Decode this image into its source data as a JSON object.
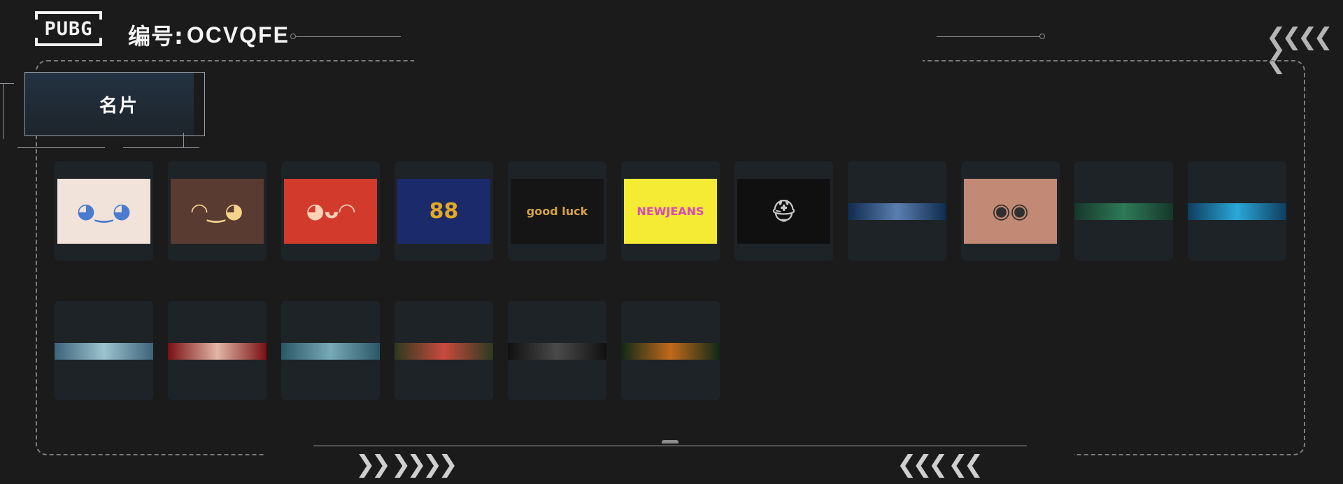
{
  "header": {
    "logo_text": "PUBG",
    "code_label": "编号:",
    "code_value": "OCVQFE"
  },
  "section": {
    "title": "名片"
  },
  "cards": [
    {
      "id": "anime-blonde",
      "type": "image",
      "bg": "#f1e3da",
      "glyph": "◕‿◕",
      "glyph_color": "#4a7bd0"
    },
    {
      "id": "anime-brunette",
      "type": "image",
      "bg": "#5a3b31",
      "glyph": "◠‿◕",
      "glyph_color": "#f4d38a"
    },
    {
      "id": "anime-red",
      "type": "image",
      "bg": "#d23a2c",
      "glyph": "◕ᴗ◠",
      "glyph_color": "#ffd2b8"
    },
    {
      "id": "gold-88",
      "type": "image",
      "bg": "#1b2a6b",
      "glyph": "88",
      "glyph_color": "#e3a91f"
    },
    {
      "id": "good-luck",
      "type": "image",
      "bg": "#151515",
      "glyph": "good luck",
      "glyph_color": "#d6a545"
    },
    {
      "id": "newjeans",
      "type": "image",
      "bg": "#f5ea34",
      "glyph": "NEWJEANS",
      "glyph_color": "#d84ab6"
    },
    {
      "id": "soldier-helmet",
      "type": "image",
      "bg": "#101010",
      "glyph": "⛑",
      "glyph_color": "#c9c9c9"
    },
    {
      "id": "moon-phases",
      "type": "banner",
      "color": "#0f2a4d",
      "accent": "#5a7fb0"
    },
    {
      "id": "goggles-woman",
      "type": "image",
      "bg": "#c28a74",
      "glyph": "◉◉",
      "glyph_color": "#2f2f2f"
    },
    {
      "id": "green-camo",
      "type": "banner",
      "color": "#16372b",
      "accent": "#2e7a57"
    },
    {
      "id": "blue-light",
      "type": "banner",
      "color": "#0f3d5f",
      "accent": "#2aa8d8"
    },
    {
      "id": "mountain-haze",
      "type": "banner",
      "color": "#3c6379",
      "accent": "#9cc3cf"
    },
    {
      "id": "red-dragon",
      "type": "banner",
      "color": "#7a0f12",
      "accent": "#e0b6a6"
    },
    {
      "id": "teal-wolf",
      "type": "banner",
      "color": "#2a5766",
      "accent": "#78a9b7"
    },
    {
      "id": "shark-teeth",
      "type": "banner",
      "color": "#2b3a1f",
      "accent": "#c94a3e"
    },
    {
      "id": "dark-tribal",
      "type": "banner",
      "color": "#101010",
      "accent": "#4a4a4a"
    },
    {
      "id": "green-eye",
      "type": "banner",
      "color": "#0f2817",
      "accent": "#c06a1a"
    }
  ],
  "decor": {
    "chevrons_left_footer": "❯❯ ❯❯❯❯",
    "chevrons_right_footer": "❮❮❮ ❮❮",
    "chevrons_top_right": "❮❮❮❮ ❮"
  }
}
